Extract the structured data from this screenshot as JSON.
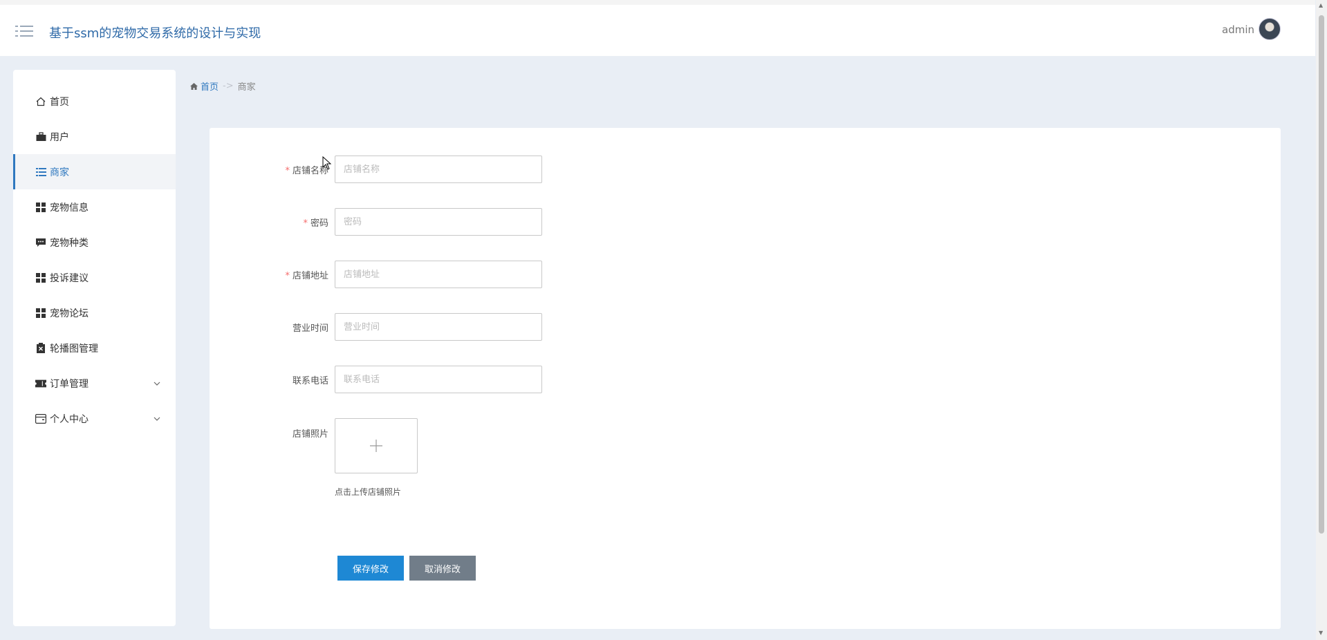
{
  "header": {
    "title": "基于ssm的宠物交易系统的设计与实现",
    "user": "admin"
  },
  "sidebar": {
    "items": [
      {
        "label": "首页",
        "icon": "home-icon"
      },
      {
        "label": "用户",
        "icon": "briefcase-icon"
      },
      {
        "label": "商家",
        "icon": "list-icon",
        "active": true
      },
      {
        "label": "宠物信息",
        "icon": "grid-icon"
      },
      {
        "label": "宠物种类",
        "icon": "comment-icon"
      },
      {
        "label": "投诉建议",
        "icon": "grid-icon"
      },
      {
        "label": "宠物论坛",
        "icon": "grid-icon"
      },
      {
        "label": "轮播图管理",
        "icon": "clipboard-icon"
      },
      {
        "label": "订单管理",
        "icon": "ticket-icon",
        "expandable": true
      },
      {
        "label": "个人中心",
        "icon": "wallet-icon",
        "expandable": true
      }
    ]
  },
  "breadcrumb": {
    "home": "首页",
    "separator": "->",
    "current": "商家"
  },
  "form": {
    "fields": [
      {
        "label": "店铺名称",
        "required": true,
        "placeholder": "店铺名称",
        "value": ""
      },
      {
        "label": "密码",
        "required": true,
        "placeholder": "密码",
        "value": ""
      },
      {
        "label": "店铺地址",
        "required": true,
        "placeholder": "店铺地址",
        "value": ""
      },
      {
        "label": "营业时间",
        "required": false,
        "placeholder": "营业时间",
        "value": ""
      },
      {
        "label": "联系电话",
        "required": false,
        "placeholder": "联系电话",
        "value": ""
      }
    ],
    "photo_label": "店铺照片",
    "photo_hint": "点击上传店铺照片",
    "required_mark": "*",
    "save_label": "保存修改",
    "cancel_label": "取消修改"
  },
  "colors": {
    "accent": "#2f78bf",
    "save_button": "#1e88d4",
    "cancel_button": "#717d89",
    "required": "#f56c6c",
    "background": "#e9eef5"
  }
}
